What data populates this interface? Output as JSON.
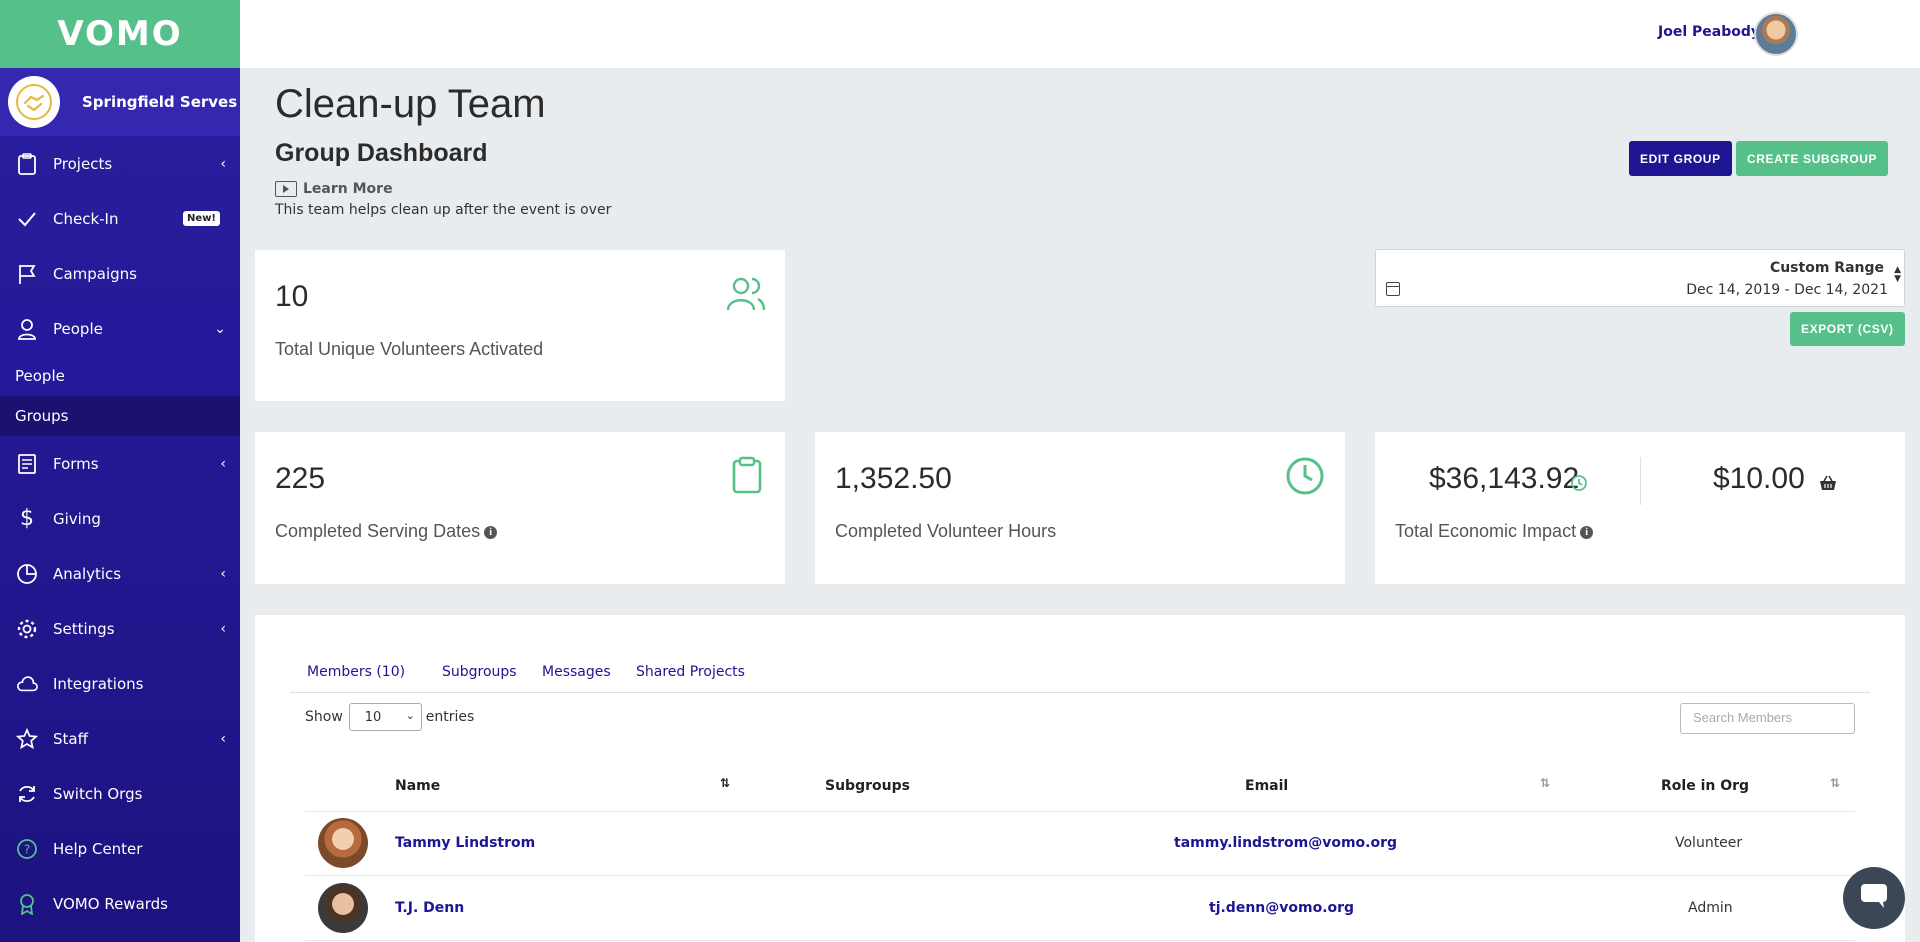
{
  "app": {
    "logo": "VOMO",
    "org_name": "Springfield Serves"
  },
  "sidebar": {
    "items": [
      {
        "label": "Projects",
        "icon": "clipboard-icon",
        "chevron": "‹"
      },
      {
        "label": "Check-In",
        "icon": "check-icon",
        "badge": "New!"
      },
      {
        "label": "Campaigns",
        "icon": "flag-icon"
      },
      {
        "label": "People",
        "icon": "person-icon",
        "chevron": "⌄"
      },
      {
        "label": "Forms",
        "icon": "form-icon",
        "chevron": "‹"
      },
      {
        "label": "Giving",
        "icon": "dollar-icon"
      },
      {
        "label": "Analytics",
        "icon": "pie-chart-icon",
        "chevron": "‹"
      },
      {
        "label": "Settings",
        "icon": "gear-icon",
        "chevron": "‹"
      },
      {
        "label": "Integrations",
        "icon": "cloud-icon"
      },
      {
        "label": "Staff",
        "icon": "star-icon",
        "chevron": "‹"
      },
      {
        "label": "Switch Orgs",
        "icon": "refresh-icon"
      },
      {
        "label": "Help Center",
        "icon": "help-icon"
      },
      {
        "label": "VOMO Rewards",
        "icon": "ribbon-icon"
      }
    ],
    "people_sub": [
      {
        "label": "People"
      },
      {
        "label": "Groups"
      }
    ]
  },
  "header": {
    "user_name": "Joel Peabody"
  },
  "page": {
    "title": "Clean-up Team",
    "subtitle": "Group Dashboard",
    "learn_more": "Learn More",
    "description": "This team helps clean up after the event is over",
    "edit_button": "EDIT GROUP",
    "create_button": "CREATE SUBGROUP",
    "export_button": "EXPORT (CSV)"
  },
  "date_range": {
    "title": "Custom Range",
    "range": "Dec 14, 2019 - Dec 14, 2021"
  },
  "stats": {
    "volunteers_value": "10",
    "volunteers_label": "Total Unique Volunteers Activated",
    "dates_value": "225",
    "dates_label": "Completed Serving Dates",
    "hours_value": "1,352.50",
    "hours_label": "Completed Volunteer Hours",
    "impact_value": "$36,143.92",
    "impact_label": "Total Economic Impact",
    "giving_value": "$10.00"
  },
  "tabs": [
    "Members (10)",
    "Subgroups",
    "Messages",
    "Shared Projects"
  ],
  "table": {
    "show_label": "Show",
    "entries_value": "10",
    "entries_label": "entries",
    "search_placeholder": "Search Members",
    "headers": {
      "name": "Name",
      "subgroups": "Subgroups",
      "email": "Email",
      "role": "Role in Org"
    },
    "rows": [
      {
        "name": "Tammy Lindstrom",
        "email": "tammy.lindstrom@vomo.org",
        "role": "Volunteer"
      },
      {
        "name": "T.J. Denn",
        "email": "tj.denn@vomo.org",
        "role": "Admin"
      }
    ]
  },
  "colors": {
    "brand_green": "#56c08a",
    "brand_navy": "#1e1592",
    "sidebar": "#2a1fa0"
  }
}
